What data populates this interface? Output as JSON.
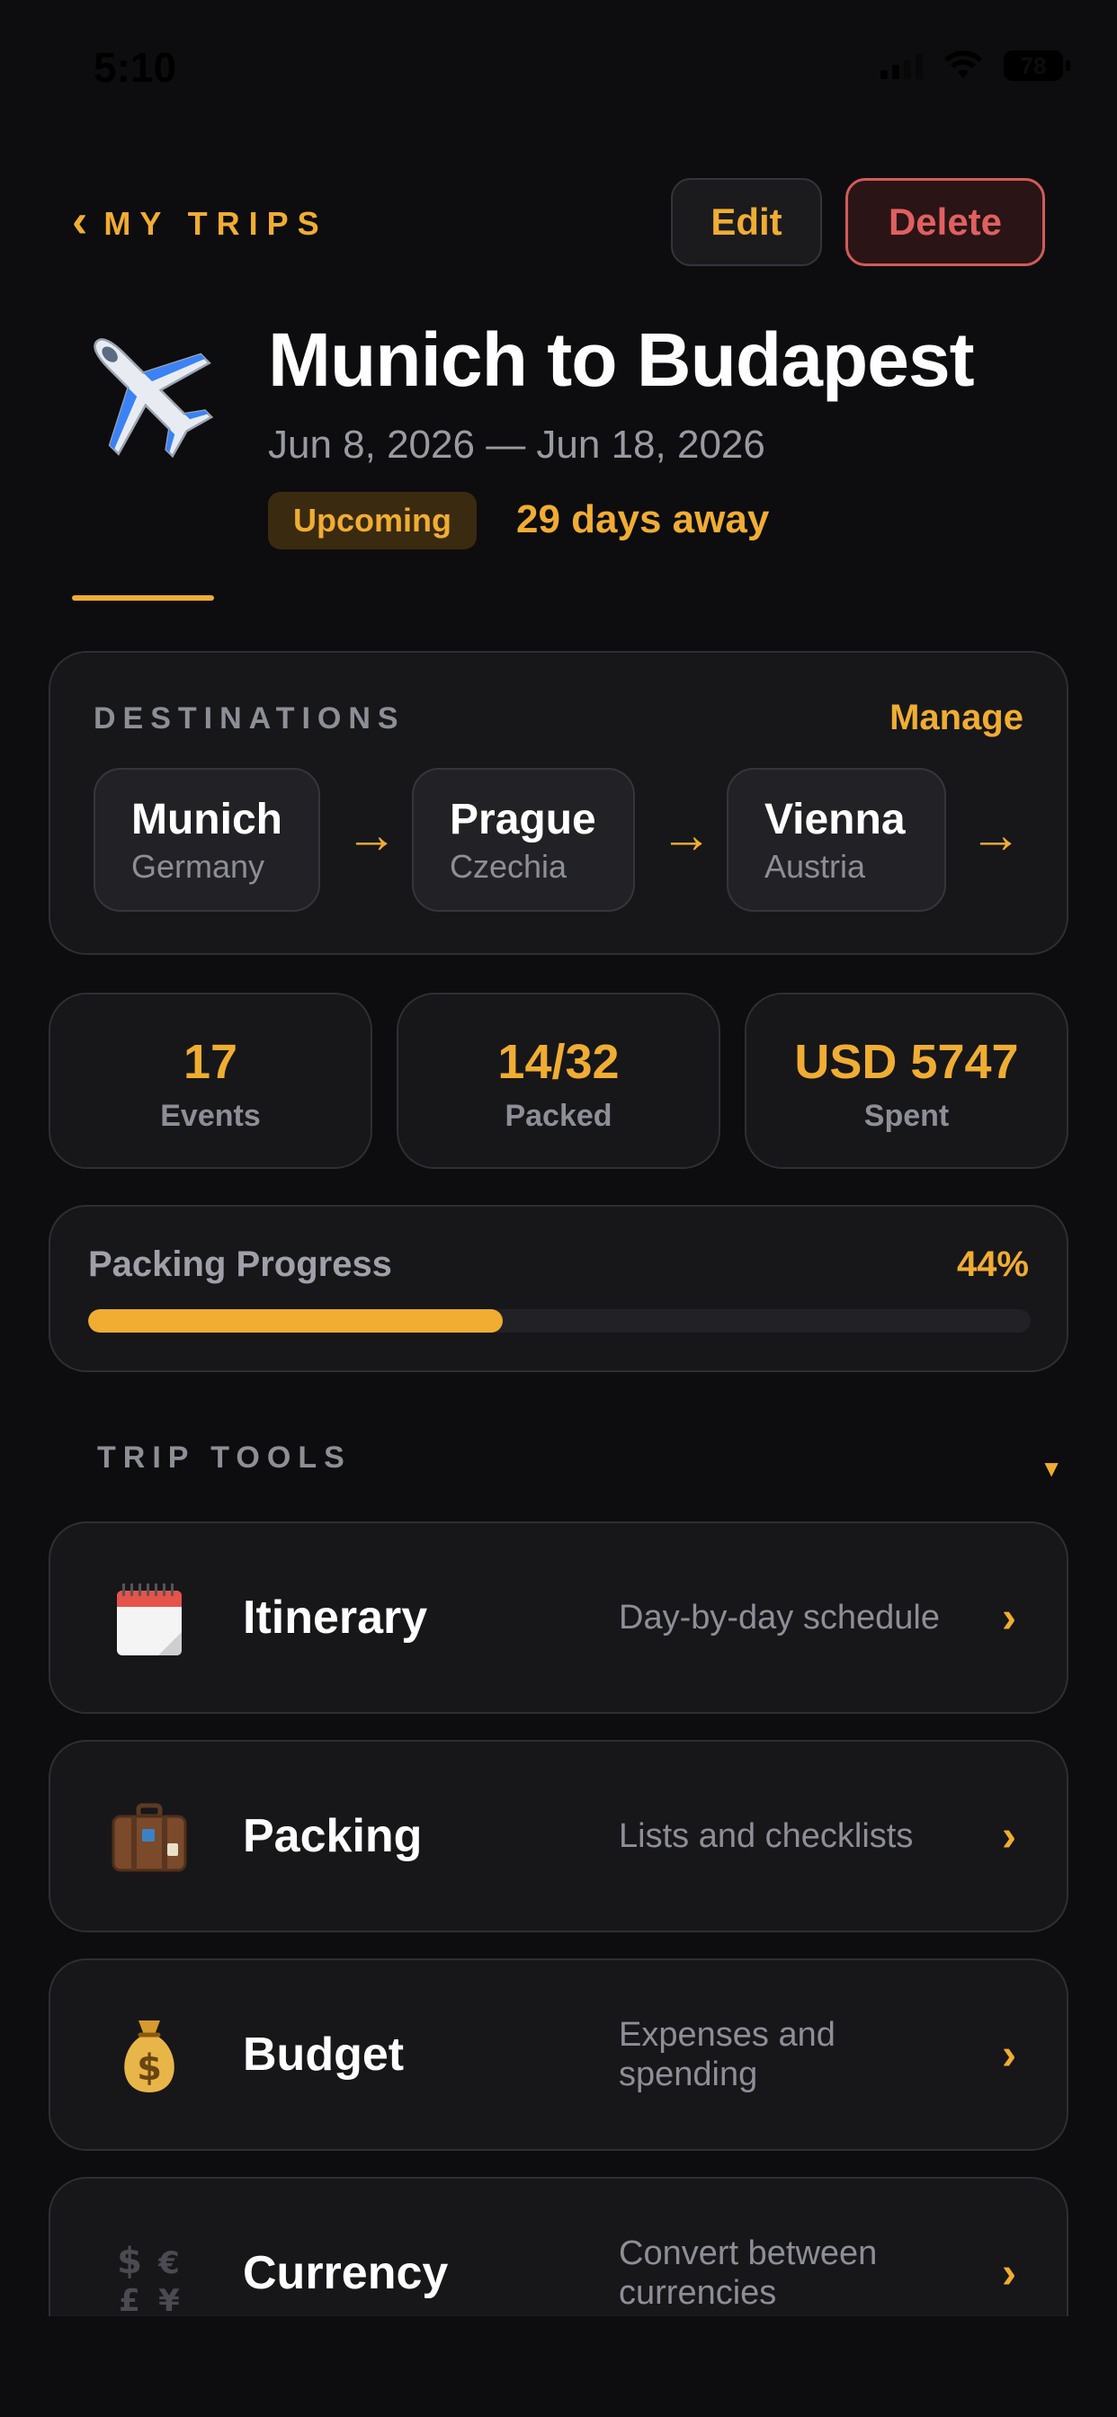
{
  "status_bar": {
    "time": "5:10",
    "battery": "78"
  },
  "header": {
    "back_label": "MY TRIPS",
    "edit_label": "Edit",
    "delete_label": "Delete"
  },
  "trip": {
    "title": "Munich to Budapest",
    "dates": "Jun 8, 2026 — Jun 18, 2026",
    "status": "Upcoming",
    "countdown": "29 days away",
    "icon": "airplane-icon"
  },
  "destinations": {
    "label": "DESTINATIONS",
    "manage_label": "Manage",
    "items": [
      {
        "city": "Munich",
        "country": "Germany"
      },
      {
        "city": "Prague",
        "country": "Czechia"
      },
      {
        "city": "Vienna",
        "country": "Austria"
      }
    ]
  },
  "stats": [
    {
      "value": "17",
      "label": "Events"
    },
    {
      "value": "14/32",
      "label": "Packed"
    },
    {
      "value": "USD 5747",
      "label": "Spent"
    }
  ],
  "packing_progress": {
    "label": "Packing Progress",
    "percent_text": "44%",
    "fraction": 0.44
  },
  "tools": {
    "label": "TRIP TOOLS",
    "items": [
      {
        "name": "Itinerary",
        "description": "Day-by-day schedule",
        "icon": "calendar-icon"
      },
      {
        "name": "Packing",
        "description": "Lists and checklists",
        "icon": "suitcase-icon"
      },
      {
        "name": "Budget",
        "description": "Expenses and spending",
        "icon": "money-bag-icon"
      },
      {
        "name": "Currency",
        "description": "Convert between currencies",
        "icon": "currency-exchange-icon"
      }
    ]
  },
  "colors": {
    "accent": "#f0ad32",
    "danger": "#e06060",
    "background": "#0d0d0f",
    "card": "#17171a"
  }
}
